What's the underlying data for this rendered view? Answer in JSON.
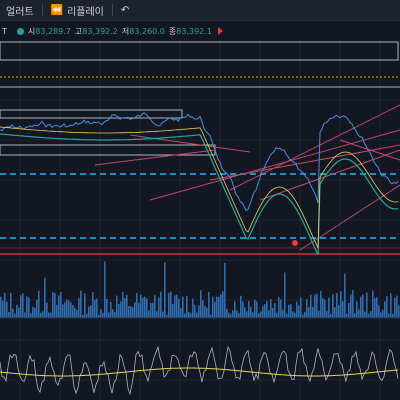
{
  "toolbar": {
    "alert_label": "얼러트",
    "replay_label": "리플레이",
    "undo_icon": "undo-icon"
  },
  "legend": {
    "symbol": "T",
    "open_key": "시",
    "open_val": "83,289.7",
    "high_key": "고",
    "high_val": "83,392.2",
    "low_key": "저",
    "low_val": "83,260.0",
    "close_key": "종",
    "close_val": "83,392.1"
  },
  "colors": {
    "background": "#131722",
    "price": "#4a90e2",
    "ma_fast": "#e8d85a",
    "ma_slow": "#26a69a",
    "down": "#f23645",
    "level": "#29b6f6"
  }
}
